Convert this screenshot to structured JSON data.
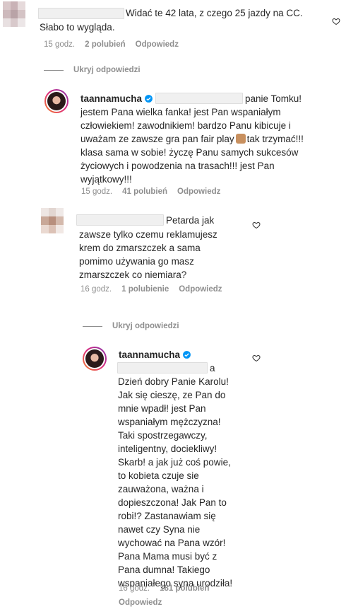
{
  "comments": [
    {
      "text_part1": "Widać te 42 lata, z czego 25 jazdy na CC.",
      "text_part2": "Słabo to wygląda.",
      "time": "15 godz.",
      "likes": "2 polubień",
      "reply": "Odpowiedz"
    },
    {
      "hide_label": "Ukryj odpowiedzi"
    },
    {
      "username": "taannamucha",
      "line1_tail": "panie Tomku!",
      "line2": "jestem Pana wielka fanka! jest Pan wspaniałym",
      "line3": "człowiekiem! zawodnikiem! bardzo Panu kibicuje i",
      "line4a": "uważam ze zawsze gra pan fair play",
      "line4b": "tak trzymać!!!",
      "line5": "klasa sama w sobie! życzę Panu samych sukcesów",
      "line6": "życiowych i powodzenia na trasach!!! jest Pan",
      "line7": "wyjątkowy!!!",
      "time": "15 godz.",
      "likes": "41 polubień",
      "reply": "Odpowiedz"
    },
    {
      "line1": "Petarda jak",
      "line2": "zawsze tylko czemu reklamujesz",
      "line3": "krem do zmarszczek a sama",
      "line4": "pomimo używania go masz",
      "line5": "zmarszczek co niemiara?",
      "time": "16 godz.",
      "likes": "1 polubienie",
      "reply": "Odpowiedz"
    },
    {
      "hide_label": "Ukryj odpowiedzi"
    },
    {
      "username": "taannamucha",
      "line1": "a",
      "lines": [
        "Dzień dobry Panie Karolu!",
        "Jak się cieszę, ze Pan do",
        "mnie wpadł! jest Pan",
        "wspaniałym mężczyzna!",
        "Taki spostrzegawczy,",
        "inteligentny, dociekliwy!",
        "Skarb! a jak już coś powie,",
        "to kobieta czuje sie",
        "zauważona, ważna i",
        "dopieszczona! Jak Pan to",
        "robi!? Zastanawiam się",
        "nawet czy Syna nie",
        "wychować na Pana wzór!",
        "Pana Mama musi być z",
        "Pana dumna! Takiego",
        "wspaniałego syna urodziła!"
      ],
      "time": "16 godz.",
      "likes": "181 polubień",
      "reply": "Odpowiedz"
    }
  ],
  "icons": {
    "heart": "heart-icon",
    "verified": "verified-badge-icon"
  },
  "colors": {
    "text": "#262626",
    "meta": "#8e8e8e",
    "verified": "#0095f6"
  }
}
